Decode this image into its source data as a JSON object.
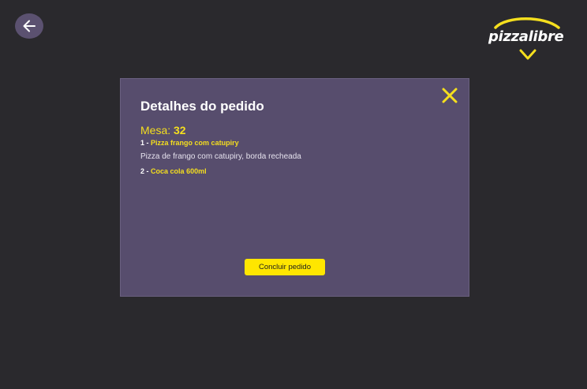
{
  "header": {
    "back_icon": "arrow-left-icon",
    "logo_text": "pizzalibre"
  },
  "modal": {
    "title": "Detalhes do pedido",
    "table_label": "Mesa:",
    "table_number": "32",
    "close_icon": "close-icon",
    "items": [
      {
        "index": "1",
        "separator": "-",
        "name": "Pizza frango com catupiry",
        "description": "Pizza de frango com catupiry, borda recheada"
      },
      {
        "index": "2",
        "separator": "-",
        "name": "Coca cola 600ml"
      }
    ],
    "finish_label": "Concluir pedido"
  },
  "colors": {
    "background": "#2a292d",
    "modal": "#574d6d",
    "accent": "#f5df1e",
    "button": "#ffe600"
  }
}
